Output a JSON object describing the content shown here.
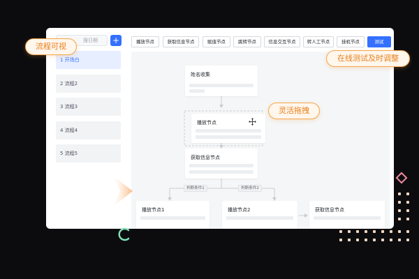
{
  "sidebar": {
    "search_placeholder": "搜日期",
    "add_label": "+",
    "items": [
      {
        "label": "1  开场白",
        "active": true
      },
      {
        "label": "2  流程2",
        "active": false
      },
      {
        "label": "3  流程3",
        "active": false
      },
      {
        "label": "4  流程4",
        "active": false
      },
      {
        "label": "5  流程5",
        "active": false
      }
    ]
  },
  "toolbar": {
    "buttons": [
      "播放节点",
      "获取信息节点",
      "赋值节点",
      "跳转节点",
      "信息交互节点",
      "转人工节点",
      "挂机节点"
    ],
    "test_label": "测试"
  },
  "canvas": {
    "node_name_collect": "姓名收集",
    "node_play_drag": "播放节点",
    "node_get_info": "获取信息节点",
    "cond1": "判断条件1",
    "cond2": "判断条件2",
    "node_play1": "播放节点1",
    "node_play2": "播放节点2",
    "node_get_info2": "获取信息节点"
  },
  "callouts": {
    "flow_visible": "流程可视",
    "online_test": "在线测试及时调整",
    "flexible_drag": "灵活拖拽"
  },
  "colors": {
    "accent": "#3370ff",
    "callout_border": "#f5a54a",
    "callout_text": "#e8801d",
    "background": "#0c0c0e"
  }
}
